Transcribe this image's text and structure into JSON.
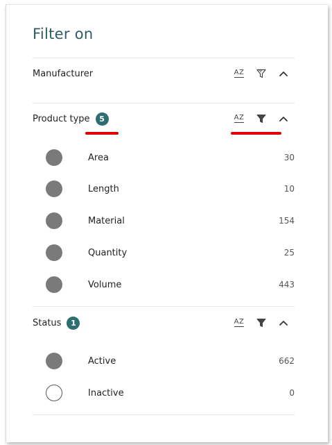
{
  "panel": {
    "title": "Filter on"
  },
  "sections": [
    {
      "label": "Manufacturer",
      "badge": null,
      "actions": {
        "sort_icon": "sort-az-icon",
        "filter_icon": "filter-outline-icon",
        "collapse_icon": "chevron-up-icon"
      },
      "options": []
    },
    {
      "label": "Product type",
      "badge": "5",
      "actions": {
        "sort_icon": "sort-az-icon",
        "filter_icon": "filter-filled-icon",
        "collapse_icon": "chevron-up-icon"
      },
      "options": [
        {
          "label": "Area",
          "count": "30",
          "selected": true
        },
        {
          "label": "Length",
          "count": "10",
          "selected": true
        },
        {
          "label": "Material",
          "count": "154",
          "selected": true
        },
        {
          "label": "Quantity",
          "count": "25",
          "selected": true
        },
        {
          "label": "Volume",
          "count": "443",
          "selected": true
        }
      ]
    },
    {
      "label": "Status",
      "badge": "1",
      "actions": {
        "sort_icon": "sort-az-icon",
        "filter_icon": "filter-filled-icon",
        "collapse_icon": "chevron-up-icon"
      },
      "options": [
        {
          "label": "Active",
          "count": "662",
          "selected": true
        },
        {
          "label": "Inactive",
          "count": "0",
          "selected": false
        }
      ]
    }
  ],
  "sort_label": "AZ",
  "colors": {
    "title": "#2f5b63",
    "badge": "#2f6e70",
    "radio_filled": "#7a7a7a",
    "annotation": "#e00000"
  }
}
